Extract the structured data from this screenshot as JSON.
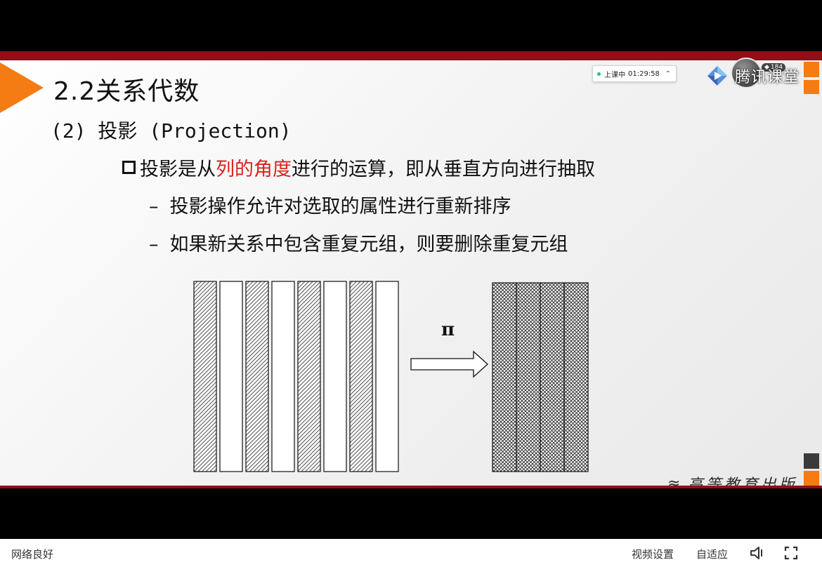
{
  "slide": {
    "title": "2.2关系代数",
    "subtitle": "(2) 投影 (Projection)",
    "bullet": {
      "before": "投影是从",
      "highlight": "列的角度",
      "after": "进行的运算，即从垂直方向进行抽取"
    },
    "sub_bullets": [
      {
        "dash": "–",
        "text": "投影操作允许对选取的属性进行重新排序"
      },
      {
        "dash": "–",
        "text": "如果新关系中包含重复元组，则要删除重复元组"
      }
    ],
    "diagram": {
      "operator": "π",
      "left_columns": [
        "hatched",
        "plain",
        "hatched",
        "plain",
        "hatched",
        "plain",
        "hatched",
        "plain"
      ],
      "right_column_count": 4
    },
    "watermark": "高等教育出版",
    "colors": {
      "accent_orange": "#f57c12",
      "bar_red": "#8f1016",
      "highlight_red": "#d8231d"
    }
  },
  "overlay": {
    "status": "上课中",
    "elapsed": "01:29:58",
    "brand": "腾讯课堂",
    "viewers": "184"
  },
  "controls": {
    "network": "网络良好",
    "video_settings": "视频设置",
    "adaptive": "自适应",
    "volume_icon": "speaker-icon",
    "fullscreen_icon": "fullscreen-icon"
  }
}
